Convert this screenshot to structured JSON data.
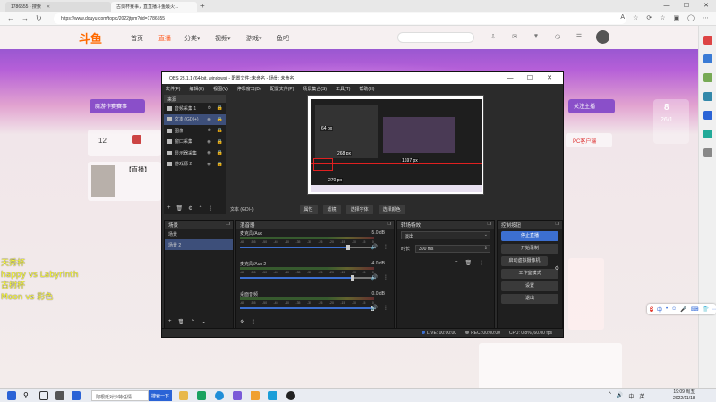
{
  "browser": {
    "tabs": [
      {
        "label": "1786555 - 搜索"
      },
      {
        "label": "古剑杯赛事，直直播斗鱼最火..."
      }
    ],
    "url": "https://www.douyu.com/topic/2022jtpm?rid=1786555",
    "win_controls": [
      "—",
      "☐",
      "✕"
    ]
  },
  "site": {
    "logo": "斗鱼",
    "nav": [
      {
        "label": "首页"
      },
      {
        "label": "直播"
      },
      {
        "label": "分类▾"
      },
      {
        "label": "视频▾"
      },
      {
        "label": "游戏▾"
      },
      {
        "label": "鱼吧"
      }
    ],
    "search_placeholder": "",
    "header_icons": [
      "下载",
      "消息",
      "关注",
      "历史",
      "任务",
      "开播"
    ],
    "left_pill": "魔游作赛赛事",
    "right_pill": "关注主播",
    "count": "12",
    "live_tag": "【直播】",
    "pc_tag": "PC客户端",
    "badge_number": "8",
    "badge_text": "26/1"
  },
  "overlay_lines": [
    "天秀杯",
    "happy vs Labyrinth",
    "古树杯",
    "Moon vs 彩色"
  ],
  "obs": {
    "title": "OBS 28.1.1 (64-bit, windows) - 配置文件: 未命名 - 场景: 未命名",
    "menu": [
      "文件(F)",
      "编辑(E)",
      "视图(V)",
      "停靠窗口(D)",
      "配置文件(P)",
      "场景集合(S)",
      "工具(T)",
      "帮助(H)"
    ],
    "sources_header": "来源",
    "sources": [
      {
        "label": "音频采集 1",
        "selected": false
      },
      {
        "label": "文本 (GDI+)",
        "selected": true
      },
      {
        "label": "图像",
        "selected": false
      },
      {
        "label": "窗口采集",
        "selected": false
      },
      {
        "label": "显示器采集",
        "selected": false
      },
      {
        "label": "游戏源 2",
        "selected": false
      }
    ],
    "preview_labels": {
      "left": "268 px",
      "right": "1697 px",
      "bottom": "270 px",
      "top": "64 px"
    },
    "subtoolbar": {
      "current": "文本 (GDI+)",
      "buttons": [
        "属性",
        "滤镜",
        "选择字体",
        "选择颜色"
      ]
    },
    "scenes": {
      "header": "场景",
      "items": [
        {
          "label": "场景",
          "selected": false
        },
        {
          "label": "场景 2",
          "selected": true
        }
      ]
    },
    "mixer": {
      "header": "混音器",
      "ticks": [
        "-60",
        "-55",
        "-50",
        "-45",
        "-40",
        "-35",
        "-30",
        "-25",
        "-20",
        "-15",
        "-10",
        "-5",
        "0"
      ],
      "channels": [
        {
          "name": "麦克风/Aux",
          "db": "-5.0 dB",
          "level": 0.82
        },
        {
          "name": "麦克风/Aux 2",
          "db": "-4.0 dB",
          "level": 0.85
        },
        {
          "name": "桌面音频",
          "db": "0.0 dB",
          "level": 1.0
        }
      ]
    },
    "transitions": {
      "header": "转场特效",
      "type": "淡出",
      "duration_label": "时长",
      "duration": "300 ms"
    },
    "controls": {
      "header": "控制按钮",
      "buttons": [
        {
          "label": "停止直播",
          "primary": true
        },
        {
          "label": "开始录制",
          "primary": false
        },
        {
          "label": "启动虚拟摄像机",
          "primary": false
        },
        {
          "label": "工作室模式",
          "primary": false
        },
        {
          "label": "设置",
          "primary": false
        },
        {
          "label": "退出",
          "primary": false
        }
      ]
    },
    "status": {
      "live": "LIVE: 00:00:00",
      "rec": "REC: 00:00:00",
      "cpu": "CPU: 0.8%, 60.00 fps"
    }
  },
  "ime": {
    "logo": "S",
    "items": [
      "中",
      "•",
      "☺",
      "🎤",
      "⌨",
      "👕",
      "⋯"
    ]
  },
  "taskbar": {
    "search_text": "阿根廷对沙特任情",
    "search_button": "搜索一下",
    "tray": [
      "^",
      "🔊",
      "中",
      "英"
    ],
    "clock_time": "19:09 周五",
    "clock_date": "2022/11/18"
  },
  "colors": {
    "accent": "#3c6fd0",
    "overlay_text": "#ffff3a",
    "site_orange": "#ff6a00"
  }
}
